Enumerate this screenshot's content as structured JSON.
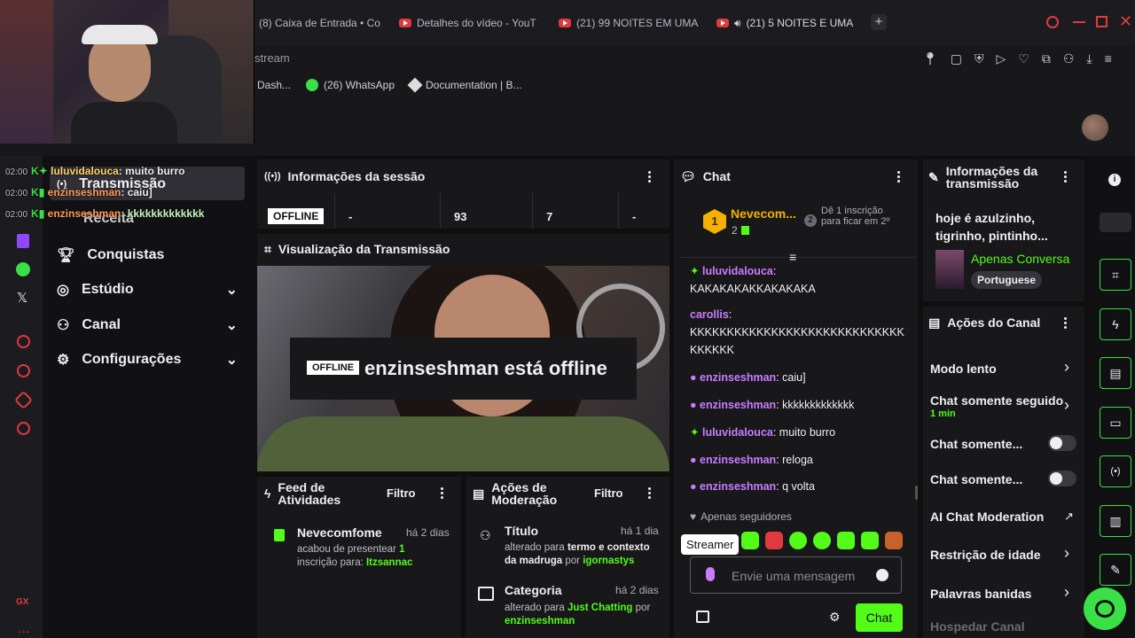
{
  "browser": {
    "tabs": [
      {
        "label": "(8) Caixa de Entrada • Co"
      },
      {
        "label": "Detalhes do vídeo - YouT"
      },
      {
        "label": "(21) 99 NOITES EM UMA"
      },
      {
        "label": "(21) 5 NOITES E UMA"
      }
    ],
    "address_fragment": "stream",
    "bookmarks": [
      {
        "label": "Dash..."
      },
      {
        "label": "(26) WhatsApp"
      },
      {
        "label": "Documentation | B..."
      }
    ]
  },
  "overlay_chat": [
    {
      "time": "02:00",
      "user": "luluvidalouca",
      "msg": ": muito burro"
    },
    {
      "time": "02:00",
      "user": "enzinseshman",
      "msg": ": caiu]"
    },
    {
      "time": "02:00",
      "user": "enzinseshman",
      "msg": ": kkkkkkkkkkkkk"
    }
  ],
  "nav": {
    "transmissao": "Transmissão",
    "receita": "Receita",
    "conquistas": "Conquistas",
    "estudio": "Estúdio",
    "canal": "Canal",
    "configuracoes": "Configurações"
  },
  "session": {
    "title": "Informações da sessão",
    "status_badge": "OFFLINE",
    "stats": [
      "-",
      "93",
      "7",
      "-"
    ]
  },
  "preview": {
    "title": "Visualização da Transmissão",
    "badge": "OFFLINE",
    "message": "enzinseshman está offline"
  },
  "feed": {
    "title": "Feed de Atividades",
    "filter": "Filtro",
    "item": {
      "user": "Nevecomfome",
      "time": "há 2 dias",
      "text1": "acabou de presentear ",
      "count": "1",
      "text2": "inscrição para: ",
      "target": "Itzsannac"
    }
  },
  "moderation": {
    "title": "Ações de Moderação",
    "filter": "Filtro",
    "items": [
      {
        "title": "Título",
        "time": "há 1 dia",
        "pre": "alterado para ",
        "value": "termo e contexto da madruga",
        "by": " por ",
        "user": "igornastys"
      },
      {
        "title": "Categoria",
        "time": "há 2 dias",
        "pre": "alterado para ",
        "value": "Just Chatting",
        "by": " por ",
        "user": "enzinseshman"
      }
    ]
  },
  "chat": {
    "title": "Chat",
    "leader": {
      "rank": "1",
      "name": "Nevecom...",
      "count": "2",
      "rank2": "2",
      "hint": "Dê 1 inscrição para ficar em 2º"
    },
    "messages": [
      {
        "user": "luluvidalouca",
        "msg": ":",
        "body": "KAKAKAKAKKAKAKAKA"
      },
      {
        "user": "carollis",
        "msg": ":",
        "body": "KKKKKKKKKKKKKKKKKKKKKKKKKKKKK KKKKKK"
      },
      {
        "user": "enzinseshman",
        "msg": ": caiu]"
      },
      {
        "user": "enzinseshman",
        "msg": ": kkkkkkkkkkkkk"
      },
      {
        "user": "luluvidalouca",
        "msg": ": muito burro"
      },
      {
        "user": "enzinseshman",
        "msg": ": reloga"
      },
      {
        "user": "enzinseshman",
        "msg": ": q volta"
      }
    ],
    "followers_only": "Apenas seguidores",
    "tooltip": "Streamer",
    "input_placeholder": "Envie uma mensagem",
    "send": "Chat"
  },
  "stream_info": {
    "title": "Informações da transmissão",
    "stream_title": "hoje é azulzinho, tigrinho, pintinho...",
    "category": "Apenas Conversa",
    "language": "Portuguese"
  },
  "channel_actions": {
    "title": "Ações do Canal",
    "items": [
      "Modo lento",
      "Chat somente seguido",
      "Chat somente...",
      "Chat somente...",
      "AI Chat Moderation",
      "Restrição de idade",
      "Palavras banidas",
      "Hospedar Canal"
    ],
    "sub": "1 min"
  },
  "colors": {
    "accent": "#53fc18",
    "twitch_green": "#3ae045",
    "yt_red": "#e03a3e"
  }
}
